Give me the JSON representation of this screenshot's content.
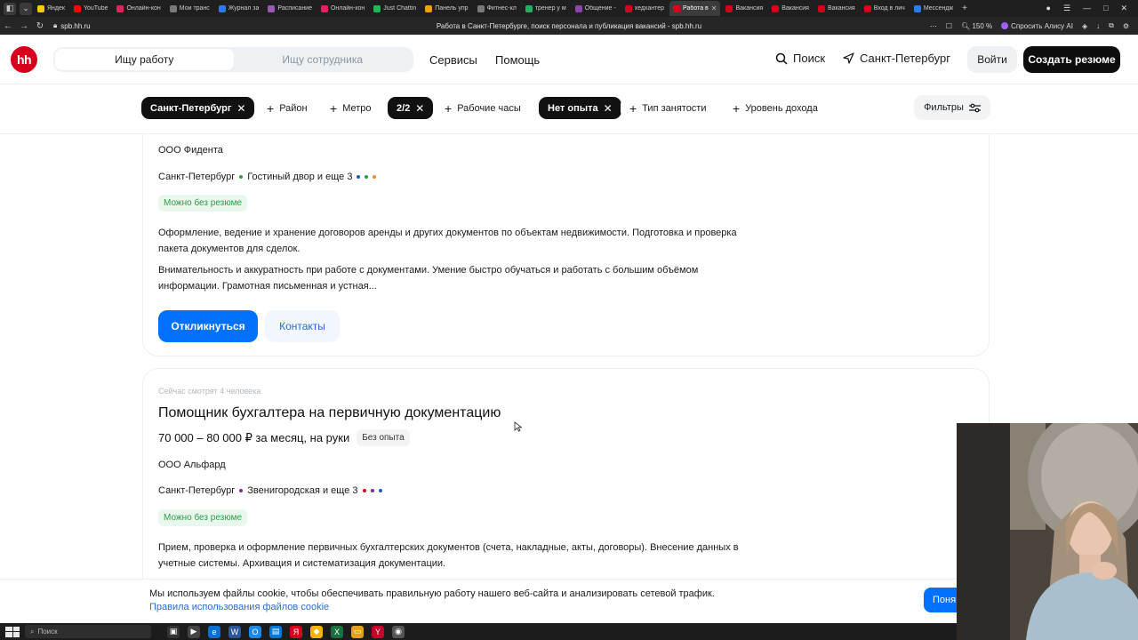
{
  "browser": {
    "tabs": [
      {
        "label": "Яндек",
        "color": "#ffcc00"
      },
      {
        "label": "YouTube",
        "color": "#ff0000"
      },
      {
        "label": "Онлайн-кон",
        "color": "#e0245e"
      },
      {
        "label": "Мои транс",
        "color": "#7a7a7a"
      },
      {
        "label": "Журнал за",
        "color": "#2b7de9"
      },
      {
        "label": "Расписание",
        "color": "#9b59b6"
      },
      {
        "label": "Онлайн-кон",
        "color": "#e0245e"
      },
      {
        "label": "Just Chattin",
        "color": "#1db954"
      },
      {
        "label": "Панель упр",
        "color": "#f39c12"
      },
      {
        "label": "Фитнес-кл",
        "color": "#7a7a7a"
      },
      {
        "label": "тренер у м",
        "color": "#27ae60"
      },
      {
        "label": "Общение -",
        "color": "#8e44ad"
      },
      {
        "label": "хедхантер",
        "color": "#d6001c"
      },
      {
        "label": "Работа в",
        "color": "#d6001c",
        "active": true
      },
      {
        "label": "Вакансия",
        "color": "#d6001c"
      },
      {
        "label": "Вакансия",
        "color": "#d6001c"
      },
      {
        "label": "Вакансия",
        "color": "#d6001c"
      },
      {
        "label": "Вход в лич",
        "color": "#d6001c"
      },
      {
        "label": "Мессендж",
        "color": "#2b7de9"
      }
    ],
    "url": "spb.hh.ru",
    "page_title": "Работа в Санкт-Петербурге, поиск персонала и публикация вакансий - spb.hh.ru",
    "zoom": "150 %",
    "alice_label": "Спросить Алису AI"
  },
  "header": {
    "logo_text": "hh",
    "role_seeker": "Ищу работу",
    "role_employer": "Ищу сотрудника",
    "services": "Сервисы",
    "help": "Помощь",
    "search": "Поиск",
    "city": "Санкт-Петербург",
    "login": "Войти",
    "create_resume": "Создать резюме"
  },
  "filters": {
    "city_chip": "Санкт-Петербург",
    "district": "Район",
    "metro": "Метро",
    "schedule_chip": "2/2",
    "work_hours": "Рабочие часы",
    "experience_chip": "Нет опыта",
    "employment_type": "Тип занятости",
    "income_level": "Уровень дохода",
    "filters_button": "Фильтры"
  },
  "vacancy1": {
    "company": "ООО Фидента",
    "city": "Санкт-Петербург",
    "metro": "Гостиный двор и еще 3",
    "no_resume": "Можно без резюме",
    "desc1": "Оформление, ведение и хранение договоров аренды и других документов по объектам недвижимости. Подготовка и проверка пакета документов для сделок.",
    "desc2": "Внимательность и аккуратность при работе с документами. Умение быстро обучаться и работать с большим объёмом информации. Грамотная письменная и устная...",
    "apply": "Откликнуться",
    "contacts": "Контакты"
  },
  "vacancy2": {
    "watching": "Сейчас смотрят 4 человека",
    "title": "Помощник бухгалтера на первичную документацию",
    "salary": "70 000 – 80 000 ₽ за месяц, на руки",
    "experience": "Без опыта",
    "company": "ООО Альфард",
    "city": "Санкт-Петербург",
    "metro": "Звенигородская и еще 3",
    "no_resume": "Можно без резюме",
    "desc1": "Прием, проверка и оформление первичных бухгалтерских документов (счета, накладные, акты, договоры). Внесение данных в учетные системы. Архивация и систематизация документации."
  },
  "cookie": {
    "text": "Мы используем файлы cookie, чтобы обеспечивать правильную работу нашего веб-сайта и анализировать сетевой трафик.",
    "link": "Правила использования файлов cookie",
    "button": "Поня"
  },
  "taskbar": {
    "search_placeholder": "Поиск"
  }
}
